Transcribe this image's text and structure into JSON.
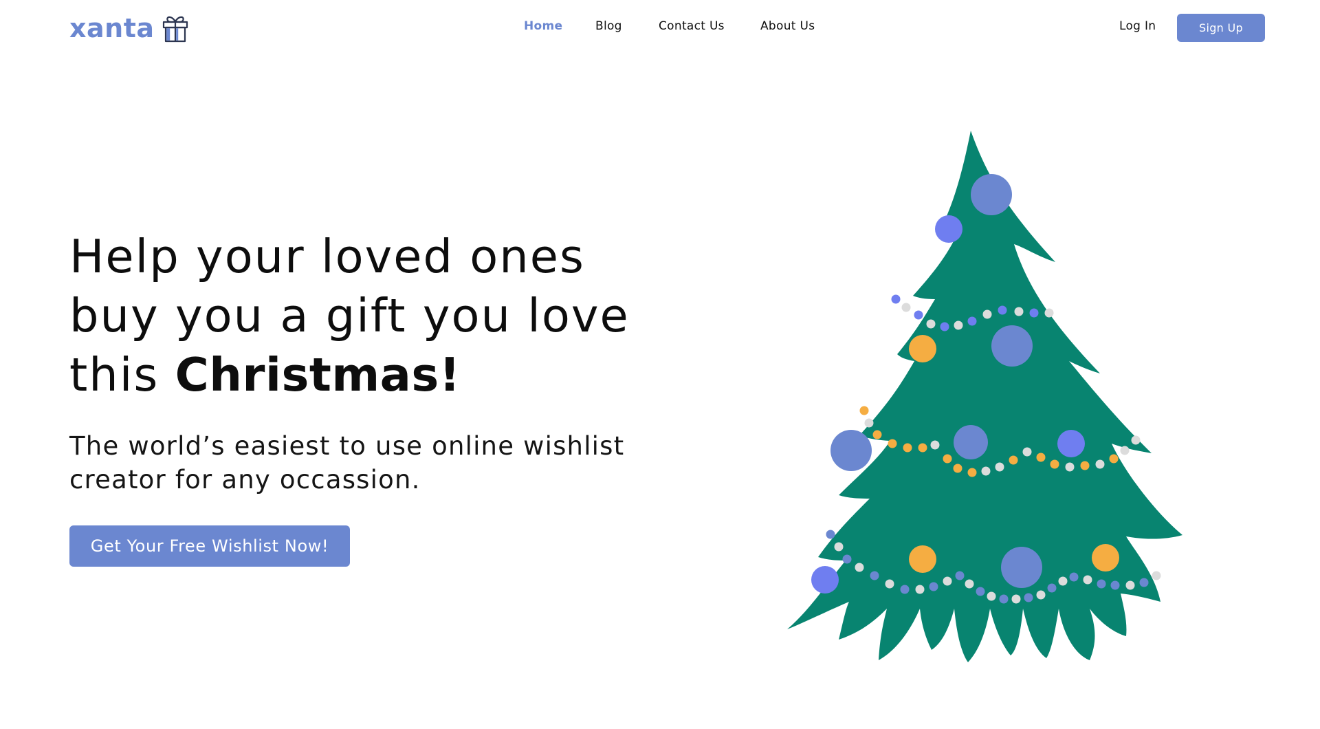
{
  "brand": {
    "name": "xanta",
    "logo_icon": "gift-icon",
    "color": "#6b87d0"
  },
  "nav": {
    "items": [
      {
        "label": "Home",
        "active": true
      },
      {
        "label": "Blog",
        "active": false
      },
      {
        "label": "Contact Us",
        "active": false
      },
      {
        "label": "About Us",
        "active": false
      }
    ],
    "active_color": "#6b87d0"
  },
  "auth": {
    "login_label": "Log In",
    "signup_label": "Sign Up"
  },
  "hero": {
    "title_line1": "Help your loved ones",
    "title_line2": "buy you a gift you love",
    "title_line3_prefix": "this ",
    "title_line3_bold": "Christmas!",
    "subtitle_line1": "The world’s easiest to use online wishlist",
    "subtitle_line2": "creator for any occassion.",
    "cta_label": "Get Your Free Wishlist Now!"
  },
  "illustration": {
    "name": "christmas-tree",
    "tree_color": "#088470",
    "ornament_colors": [
      "#6b87d0",
      "#6f7ef0",
      "#f5ad42",
      "#dcdcdc"
    ]
  },
  "theme": {
    "primary": "#6b87d0",
    "text": "#111111",
    "background": "#ffffff"
  }
}
